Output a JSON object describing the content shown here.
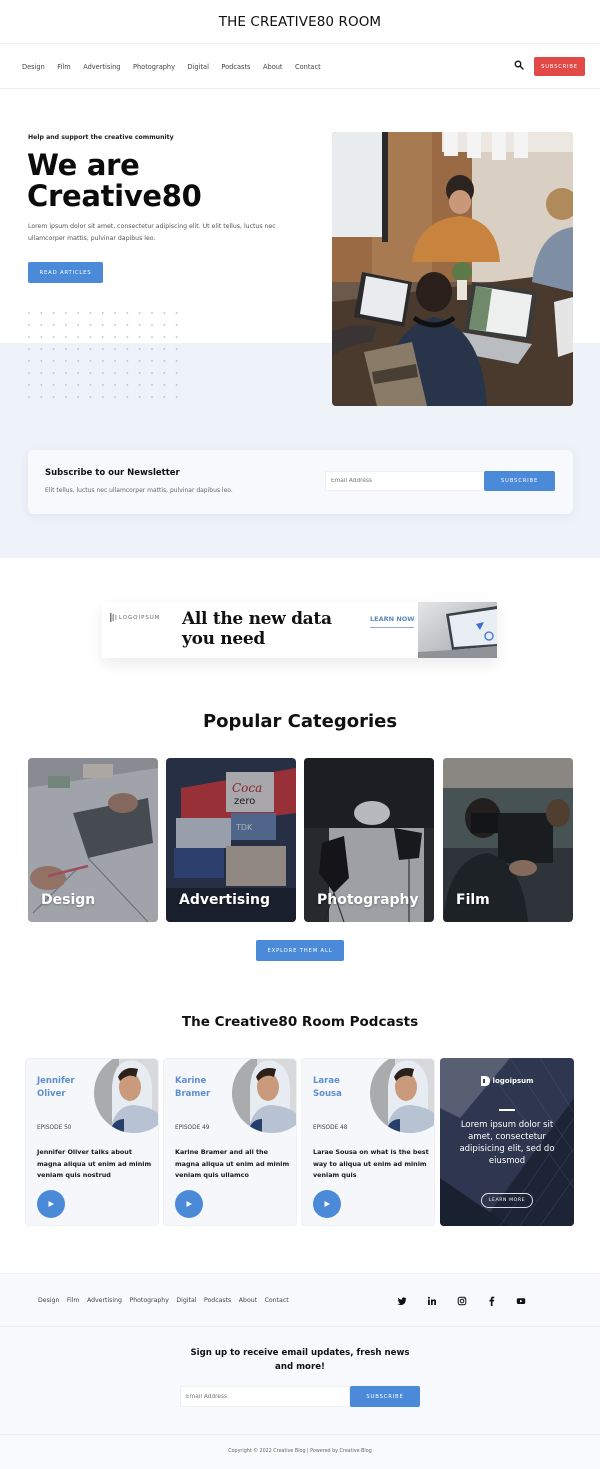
{
  "header": {
    "site_title": "THE CREATIVE80 ROOM",
    "nav": [
      "Design",
      "Film",
      "Advertising",
      "Photography",
      "Digital",
      "Podcasts",
      "About",
      "Contact"
    ],
    "search_icon": "search-icon",
    "subscribe_label": "SUBSCRIBE",
    "subscribe_color": "#e24a47"
  },
  "hero": {
    "kicker": "Help and support the creative community",
    "title_line1": "We are",
    "title_line2": "Creative80",
    "text": "Lorem ipsum dolor sit amet, consectetur adipiscing elit. Ut elit tellus, luctus nec ullamcorper mattis, pulvinar dapibus leo.",
    "button_label": "READ ARTICLES",
    "image_alt": "People working on laptops around a table"
  },
  "newsletter": {
    "title": "Subscribe to our Newsletter",
    "text": "Elit tellus, luctus nec ullamcorper mattis, pulvinar dapibus leo.",
    "email_placeholder": "Email Address",
    "button_label": "SUBSCRIBE"
  },
  "ad_banner": {
    "logo_text": "LOGOIPSUM",
    "headline_line1": "All the new data",
    "headline_line2": "you need",
    "cta": "LEARN NOW"
  },
  "categories": {
    "heading": "Popular Categories",
    "items": [
      {
        "label": "Design"
      },
      {
        "label": "Advertising"
      },
      {
        "label": "Photography"
      },
      {
        "label": "Film"
      }
    ],
    "button_label": "EXPLORE THEM ALL"
  },
  "podcasts": {
    "heading": "The Creative80 Room Podcasts",
    "items": [
      {
        "name_line1": "Jennifer",
        "name_line2": "Oliver",
        "episode": "EPISODE 50",
        "description": "Jennifer Oliver talks about magna aliqua ut enim ad minim veniam quis nostrud"
      },
      {
        "name_line1": "Karine",
        "name_line2": "Bramer",
        "episode": "EPISODE 49",
        "description": "Karine Bramer and all the magna aliqua ut enim ad minim veniam quis ullamco"
      },
      {
        "name_line1": "Larae",
        "name_line2": "Sousa",
        "episode": "EPISODE 48",
        "description": "Larae Sousa on what is the best way to aliqua ut enim ad minim veniam quis"
      }
    ],
    "promo": {
      "logo_text": "logoipsum",
      "text": "Lorem ipsum dolor sit amet, consectetur adipisicing elit, sed do eiusmod",
      "button_label": "LEARN MORE"
    }
  },
  "footer": {
    "nav": [
      "Design",
      "Film",
      "Advertising",
      "Photography",
      "Digital",
      "Podcasts",
      "About",
      "Contact"
    ],
    "social": [
      "twitter-icon",
      "linkedin-icon",
      "instagram-icon",
      "facebook-icon",
      "youtube-icon"
    ],
    "signup_title": "Sign up to receive email updates, fresh news and more!",
    "email_placeholder": "Email Address",
    "button_label": "SUBSCRIBE",
    "copyright": "Copyright © 2022 Creative Blog | Powered by Creative Blog"
  },
  "colors": {
    "accent": "#4a8ad8",
    "subscribe_red": "#e24a47",
    "hero_band": "#eef2f9",
    "podcast_name": "#5d8fcf"
  }
}
